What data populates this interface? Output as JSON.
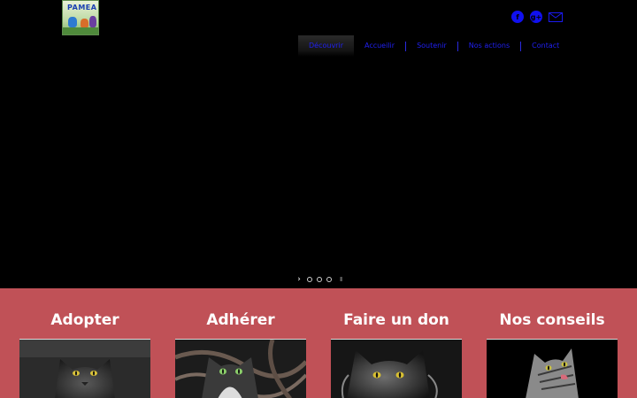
{
  "header": {
    "logo_text": "PAMEA",
    "social": [
      {
        "name": "facebook",
        "glyph": "f"
      },
      {
        "name": "google-plus",
        "glyph": "g+"
      },
      {
        "name": "email",
        "glyph": ""
      }
    ]
  },
  "nav": {
    "items": [
      {
        "label": "Découvrir",
        "active": true
      },
      {
        "label": "Accueilir",
        "active": false
      },
      {
        "label": "Soutenir",
        "active": false
      },
      {
        "label": "Nos actions",
        "active": false
      },
      {
        "label": "Contact",
        "active": false
      }
    ]
  },
  "slider": {
    "next_glyph": "›",
    "dot_count": 3,
    "pause_glyph": "II"
  },
  "features": [
    {
      "title": "Adopter",
      "icon": "grey-cat-photo"
    },
    {
      "title": "Adhérer",
      "icon": "cat-in-yarn-photo"
    },
    {
      "title": "Faire un don",
      "icon": "long-hair-cat-photo"
    },
    {
      "title": "Nos conseils",
      "icon": "tabby-cat-photo"
    }
  ],
  "colors": {
    "background": "#000000",
    "accent_link": "#2020f0",
    "feature_band": "#c05157",
    "feature_title": "#ffffff"
  }
}
